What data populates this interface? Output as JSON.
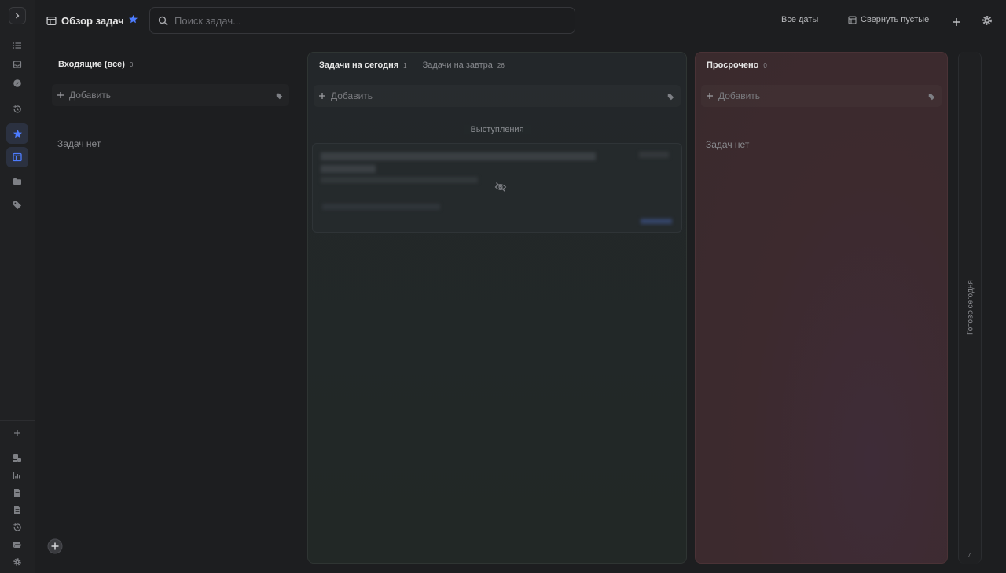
{
  "header": {
    "title": "Обзор задач",
    "search_placeholder": "Поиск задач...",
    "all_dates": "Все даты",
    "collapse_empty": "Свернуть пустые"
  },
  "columns": {
    "inbox": {
      "title": "Входящие (все)",
      "count": "0",
      "add_label": "Добавить",
      "empty_text": "Задач нет"
    },
    "today": {
      "title": "Задачи на сегодня",
      "count": "1",
      "tab2_title": "Задачи на завтра",
      "tab2_count": "26",
      "add_label": "Добавить",
      "group_label": "Выступления"
    },
    "overdue": {
      "title": "Просрочено",
      "count": "0",
      "add_label": "Добавить",
      "empty_text": "Задач нет"
    },
    "done": {
      "title": "Готово сегодня",
      "count": "7"
    }
  },
  "colors": {
    "accent": "#4d7cff",
    "overdue_bg": "#3d2a2e"
  }
}
